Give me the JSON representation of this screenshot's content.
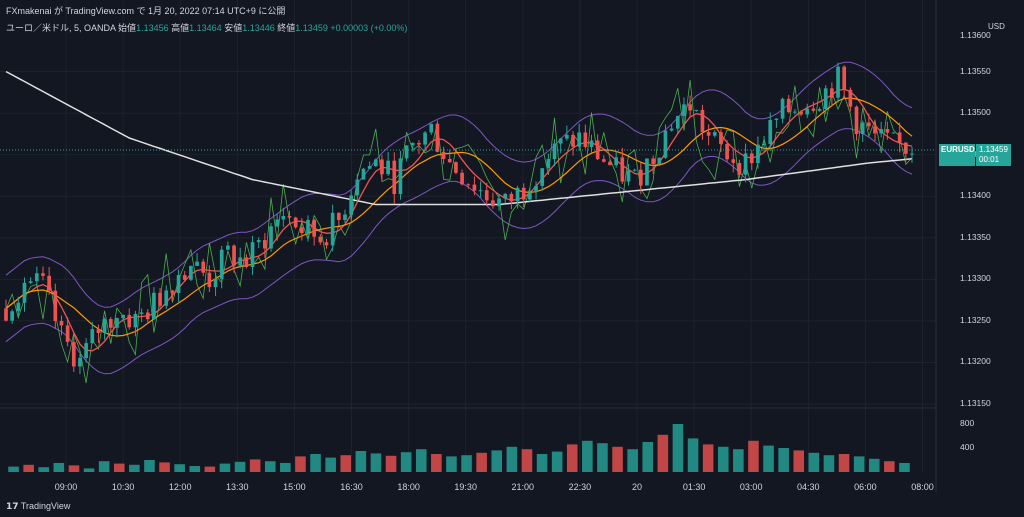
{
  "header": {
    "attribution": "FXmakenai が TradingView.com で 1月 20, 2022 07:14 UTC+9 に公開",
    "symbol_line": "ユーロ／米ドル, 5, OANDA",
    "open_label": "始値",
    "open_value": "1.13456",
    "high_label": "高値",
    "high_value": "1.13464",
    "low_label": "安値",
    "low_value": "1.13446",
    "close_label": "終値",
    "close_value": "1.13459",
    "change": "+0.00003 (+0.00%)"
  },
  "currency": "USD",
  "price_tag": {
    "symbol": "EURUSD",
    "price": "1.13459",
    "countdown": "00:01"
  },
  "footer": {
    "brand": "TradingView"
  },
  "colors": {
    "up": "#26a69a",
    "down": "#ef5350",
    "background": "#131722"
  },
  "chart_data": {
    "type": "candlestick",
    "price_axis": {
      "ticks": [
        "1.13550",
        "1.13500",
        "1.13450",
        "1.13400",
        "1.13350",
        "1.13300",
        "1.13250",
        "1.13200",
        "1.13150"
      ],
      "top_label": "1.13600"
    },
    "volume_axis": {
      "ticks": [
        "800",
        "400"
      ]
    },
    "x_ticks": [
      "09:00",
      "10:30",
      "12:00",
      "13:30",
      "15:00",
      "16:30",
      "18:00",
      "19:30",
      "21:00",
      "22:30",
      "20",
      "01:30",
      "03:00",
      "04:30",
      "06:00",
      "08:00"
    ],
    "price_path": [
      [
        0,
        1.13265
      ],
      [
        3,
        1.133
      ],
      [
        6,
        1.1329
      ],
      [
        9,
        1.1323
      ],
      [
        12,
        1.132
      ],
      [
        15,
        1.1324
      ],
      [
        18,
        1.1326
      ],
      [
        21,
        1.1325
      ],
      [
        24,
        1.1327
      ],
      [
        27,
        1.133
      ],
      [
        30,
        1.1332
      ],
      [
        33,
        1.133
      ],
      [
        36,
        1.1333
      ],
      [
        39,
        1.1332
      ],
      [
        42,
        1.1335
      ],
      [
        45,
        1.1338
      ],
      [
        48,
        1.1336
      ],
      [
        51,
        1.1335
      ],
      [
        54,
        1.1337
      ],
      [
        57,
        1.1343
      ],
      [
        60,
        1.1344
      ],
      [
        63,
        1.1342
      ],
      [
        66,
        1.1346
      ],
      [
        69,
        1.1348
      ],
      [
        72,
        1.1344
      ],
      [
        75,
        1.1342
      ],
      [
        78,
        1.134
      ],
      [
        81,
        1.1339
      ],
      [
        84,
        1.1341
      ],
      [
        87,
        1.1344
      ],
      [
        90,
        1.1346
      ],
      [
        93,
        1.1347
      ],
      [
        96,
        1.1345
      ],
      [
        99,
        1.1343
      ],
      [
        102,
        1.1342
      ],
      [
        105,
        1.1345
      ],
      [
        108,
        1.1349
      ],
      [
        111,
        1.1351
      ],
      [
        114,
        1.1347
      ],
      [
        117,
        1.1345
      ],
      [
        120,
        1.1344
      ],
      [
        123,
        1.1347
      ],
      [
        126,
        1.135
      ],
      [
        129,
        1.1351
      ],
      [
        132,
        1.1352
      ],
      [
        135,
        1.1354
      ],
      [
        138,
        1.1349
      ],
      [
        141,
        1.1347
      ],
      [
        144,
        1.1346
      ],
      [
        147,
        1.13459
      ]
    ],
    "ma_slow_path": [
      [
        0,
        1.1355
      ],
      [
        20,
        1.1347
      ],
      [
        40,
        1.1342
      ],
      [
        60,
        1.1339
      ],
      [
        80,
        1.1339
      ],
      [
        100,
        1.13405
      ],
      [
        120,
        1.1342
      ],
      [
        140,
        1.1344
      ],
      [
        147,
        1.13445
      ]
    ],
    "volumes": [
      90,
      120,
      80,
      150,
      110,
      60,
      180,
      140,
      120,
      200,
      160,
      130,
      100,
      90,
      140,
      170,
      210,
      180,
      150,
      260,
      300,
      240,
      280,
      350,
      310,
      270,
      330,
      380,
      300,
      260,
      280,
      320,
      360,
      420,
      380,
      300,
      340,
      460,
      520,
      480,
      420,
      380,
      500,
      620,
      800,
      560,
      460,
      420,
      380,
      520,
      440,
      400,
      360,
      320,
      280,
      300,
      260,
      220,
      180,
      150
    ]
  }
}
